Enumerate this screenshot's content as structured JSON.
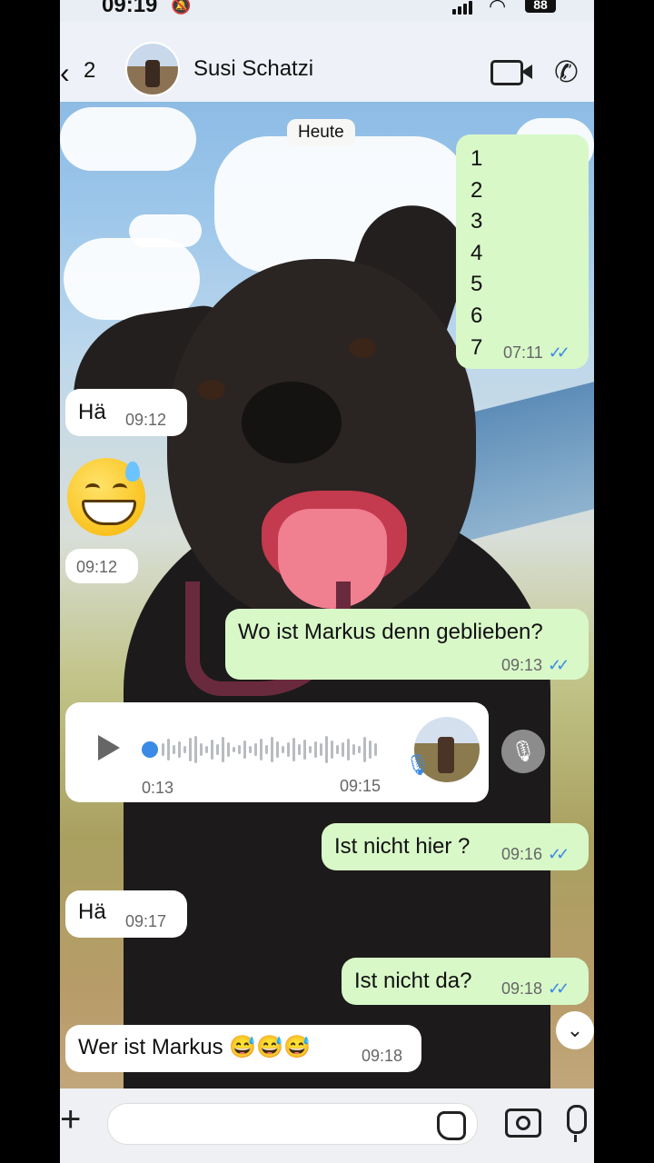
{
  "status_bar": {
    "time": "09:19",
    "battery": "88"
  },
  "header": {
    "back_count": "2",
    "contact_name": "Susi Schatzi"
  },
  "date_chip": "Heute",
  "messages": [
    {
      "dir": "out",
      "lines": [
        "1",
        "2",
        "3",
        "4",
        "5",
        "6",
        "7"
      ],
      "time": "07:11",
      "read": true
    },
    {
      "dir": "in",
      "text": "Hä",
      "time": "09:12"
    },
    {
      "dir": "in",
      "emoji": "grinning-face-with-sweat",
      "time": "09:12"
    },
    {
      "dir": "out",
      "text": "Wo ist Markus denn geblieben?",
      "time": "09:13",
      "read": true
    },
    {
      "dir": "in",
      "type": "voice",
      "duration": "0:13",
      "time": "09:15"
    },
    {
      "dir": "out",
      "text": "Ist nicht hier ?",
      "time": "09:16",
      "read": true
    },
    {
      "dir": "in",
      "text": "Hä",
      "time": "09:17"
    },
    {
      "dir": "out",
      "text": "Ist nicht da?",
      "time": "09:18",
      "read": true
    },
    {
      "dir": "in",
      "text": "Wer ist Markus 😅😅😅",
      "time": "09:18"
    }
  ],
  "colors": {
    "outgoing_bubble": "#d8f8c8",
    "incoming_bubble": "#ffffff",
    "read_ticks": "#3a8ae6"
  },
  "icons": [
    "back-chevron-icon",
    "video-call-icon",
    "phone-icon",
    "play-icon",
    "mic-icon",
    "chevron-down-icon",
    "plus-icon",
    "sticker-icon",
    "camera-icon"
  ]
}
